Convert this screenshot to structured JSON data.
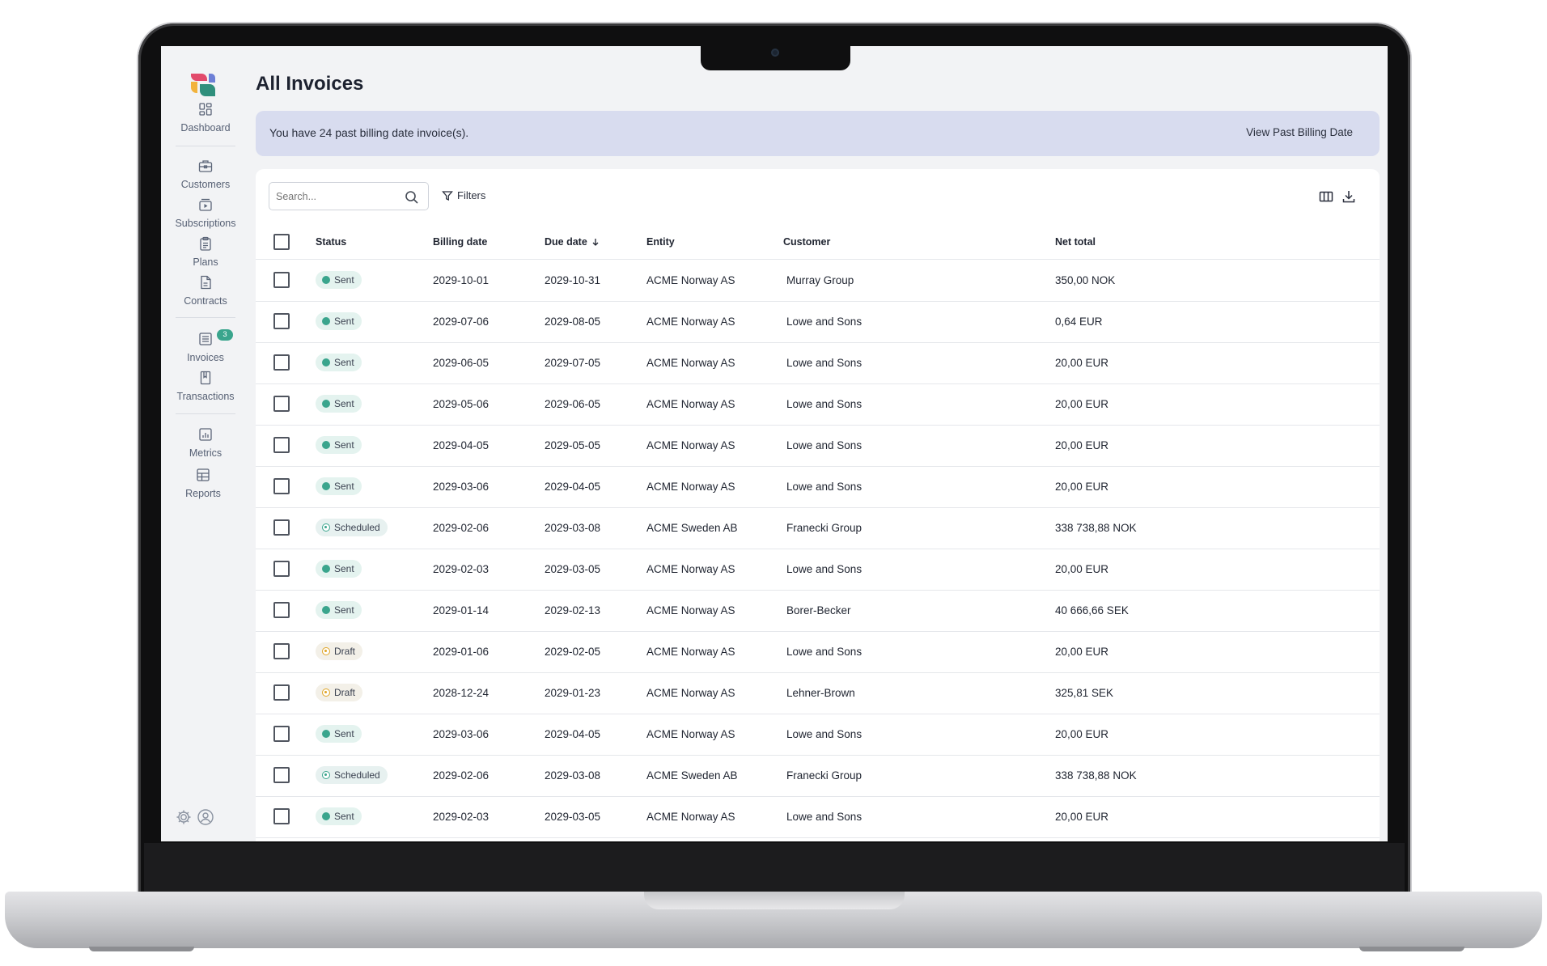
{
  "page": {
    "title": "All Invoices"
  },
  "banner": {
    "message": "You have 24 past billing date invoice(s).",
    "link_label": "View Past Billing Date"
  },
  "sidebar": {
    "items": [
      {
        "label": "Dashboard",
        "icon": "dashboard-icon"
      },
      {
        "label": "Customers",
        "icon": "briefcase-icon"
      },
      {
        "label": "Subscriptions",
        "icon": "subscriptions-icon"
      },
      {
        "label": "Plans",
        "icon": "clipboard-icon"
      },
      {
        "label": "Contracts",
        "icon": "document-icon"
      },
      {
        "label": "Invoices",
        "icon": "invoice-list-icon",
        "badge": "3"
      },
      {
        "label": "Transactions",
        "icon": "book-icon"
      },
      {
        "label": "Metrics",
        "icon": "chart-icon"
      },
      {
        "label": "Reports",
        "icon": "table-icon"
      }
    ]
  },
  "toolbar": {
    "search_placeholder": "Search...",
    "filters_label": "Filters"
  },
  "table": {
    "columns": {
      "status": "Status",
      "billing_date": "Billing date",
      "due_date": "Due date",
      "entity": "Entity",
      "customer": "Customer",
      "net_total": "Net total"
    },
    "rows": [
      {
        "status": "Sent",
        "kind": "sent",
        "billing_date": "2029-10-01",
        "due_date": "2029-10-31",
        "entity": "ACME Norway AS",
        "customer": "Murray Group",
        "net_total": "350,00 NOK"
      },
      {
        "status": "Sent",
        "kind": "sent",
        "billing_date": "2029-07-06",
        "due_date": "2029-08-05",
        "entity": "ACME Norway AS",
        "customer": "Lowe and Sons",
        "net_total": "0,64 EUR"
      },
      {
        "status": "Sent",
        "kind": "sent",
        "billing_date": "2029-06-05",
        "due_date": "2029-07-05",
        "entity": "ACME Norway AS",
        "customer": "Lowe and Sons",
        "net_total": "20,00 EUR"
      },
      {
        "status": "Sent",
        "kind": "sent",
        "billing_date": "2029-05-06",
        "due_date": "2029-06-05",
        "entity": "ACME Norway AS",
        "customer": "Lowe and Sons",
        "net_total": "20,00 EUR"
      },
      {
        "status": "Sent",
        "kind": "sent",
        "billing_date": "2029-04-05",
        "due_date": "2029-05-05",
        "entity": "ACME Norway AS",
        "customer": "Lowe and Sons",
        "net_total": "20,00 EUR"
      },
      {
        "status": "Sent",
        "kind": "sent",
        "billing_date": "2029-03-06",
        "due_date": "2029-04-05",
        "entity": "ACME Norway AS",
        "customer": "Lowe and Sons",
        "net_total": "20,00 EUR"
      },
      {
        "status": "Scheduled",
        "kind": "scheduled",
        "billing_date": "2029-02-06",
        "due_date": "2029-03-08",
        "entity": "ACME Sweden AB",
        "customer": "Franecki Group",
        "net_total": "338 738,88 NOK"
      },
      {
        "status": "Sent",
        "kind": "sent",
        "billing_date": "2029-02-03",
        "due_date": "2029-03-05",
        "entity": "ACME Norway AS",
        "customer": "Lowe and Sons",
        "net_total": "20,00 EUR"
      },
      {
        "status": "Sent",
        "kind": "sent",
        "billing_date": "2029-01-14",
        "due_date": "2029-02-13",
        "entity": "ACME Norway AS",
        "customer": "Borer-Becker",
        "net_total": "40 666,66 SEK"
      },
      {
        "status": "Draft",
        "kind": "draft",
        "billing_date": "2029-01-06",
        "due_date": "2029-02-05",
        "entity": "ACME Norway AS",
        "customer": "Lowe and Sons",
        "net_total": "20,00 EUR"
      },
      {
        "status": "Draft",
        "kind": "draft",
        "billing_date": "2028-12-24",
        "due_date": "2029-01-23",
        "entity": "ACME Norway AS",
        "customer": "Lehner-Brown",
        "net_total": "325,81 SEK"
      },
      {
        "status": "Sent",
        "kind": "sent",
        "billing_date": "2029-03-06",
        "due_date": "2029-04-05",
        "entity": "ACME Norway AS",
        "customer": "Lowe and Sons",
        "net_total": "20,00 EUR"
      },
      {
        "status": "Scheduled",
        "kind": "scheduled",
        "billing_date": "2029-02-06",
        "due_date": "2029-03-08",
        "entity": "ACME Sweden AB",
        "customer": "Franecki Group",
        "net_total": "338 738,88 NOK"
      },
      {
        "status": "Sent",
        "kind": "sent",
        "billing_date": "2029-02-03",
        "due_date": "2029-03-05",
        "entity": "ACME Norway AS",
        "customer": "Lowe and Sons",
        "net_total": "20,00 EUR"
      }
    ]
  },
  "colors": {
    "accent": "#3aa58d",
    "banner": "#d8dcef",
    "draft": "#e0a526"
  }
}
